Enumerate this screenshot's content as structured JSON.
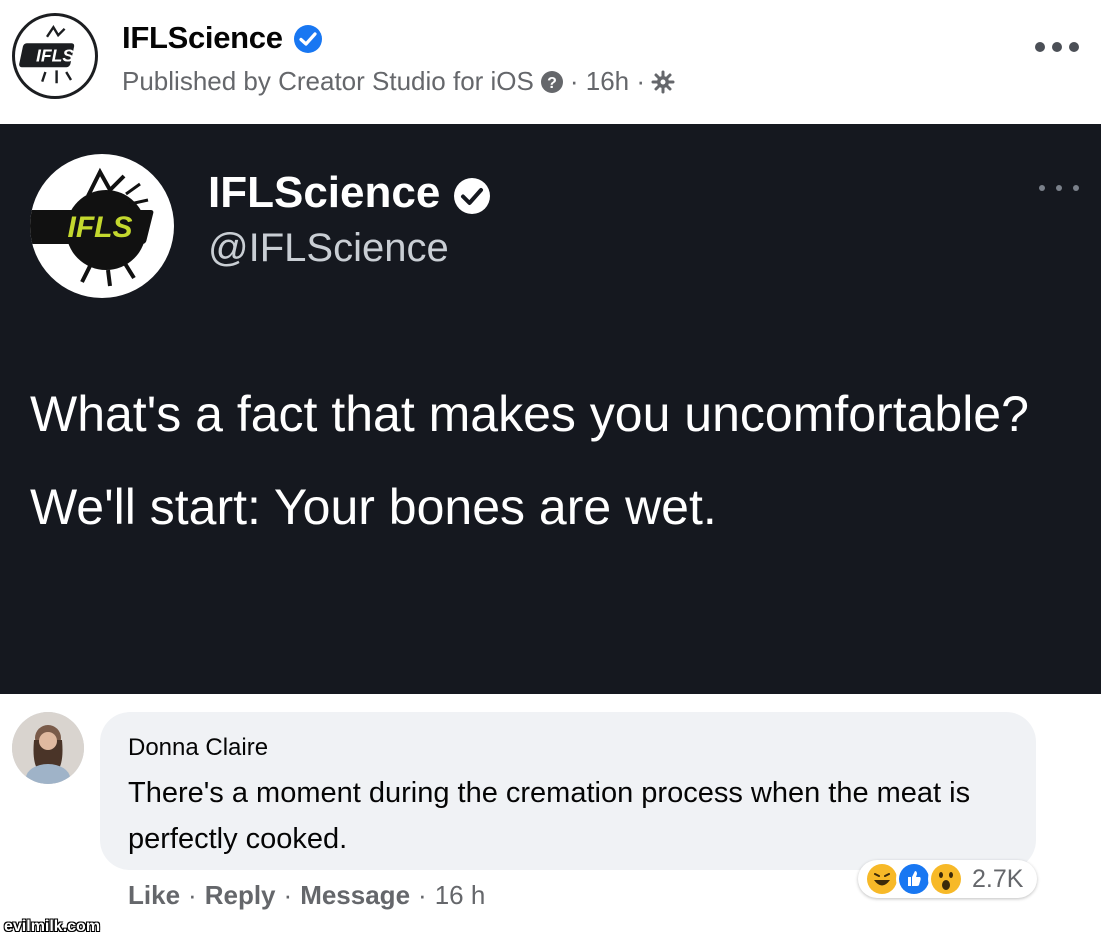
{
  "post": {
    "page_name": "IFLScience",
    "meta_text": "Published by Creator Studio for iOS",
    "time": "· 16h ·",
    "avatar_label": "IFLS"
  },
  "tweet": {
    "name": "IFLScience",
    "handle": "@IFLScience",
    "avatar_label": "IFLS",
    "text": "What's a fact that makes you uncomfortable? We'll start: Your bones are wet."
  },
  "comment": {
    "author": "Donna Claire",
    "text": "There's a moment during the cremation process when the meat is perfectly cooked.",
    "reaction_count": "2.7K",
    "actions": {
      "like": "Like",
      "reply": "Reply",
      "message": "Message",
      "time": "16 h"
    }
  },
  "watermark": "evilmilk.com",
  "colors": {
    "facebook_blue": "#1877f2",
    "tweet_background": "#15181f",
    "comment_bubble": "#f0f2f5",
    "ifls_green": "#c4d82e"
  },
  "icons": [
    "verified-badge-icon",
    "help-circle-icon",
    "gear-icon",
    "more-options-icon",
    "haha-reaction-icon",
    "like-reaction-icon",
    "wow-reaction-icon"
  ]
}
